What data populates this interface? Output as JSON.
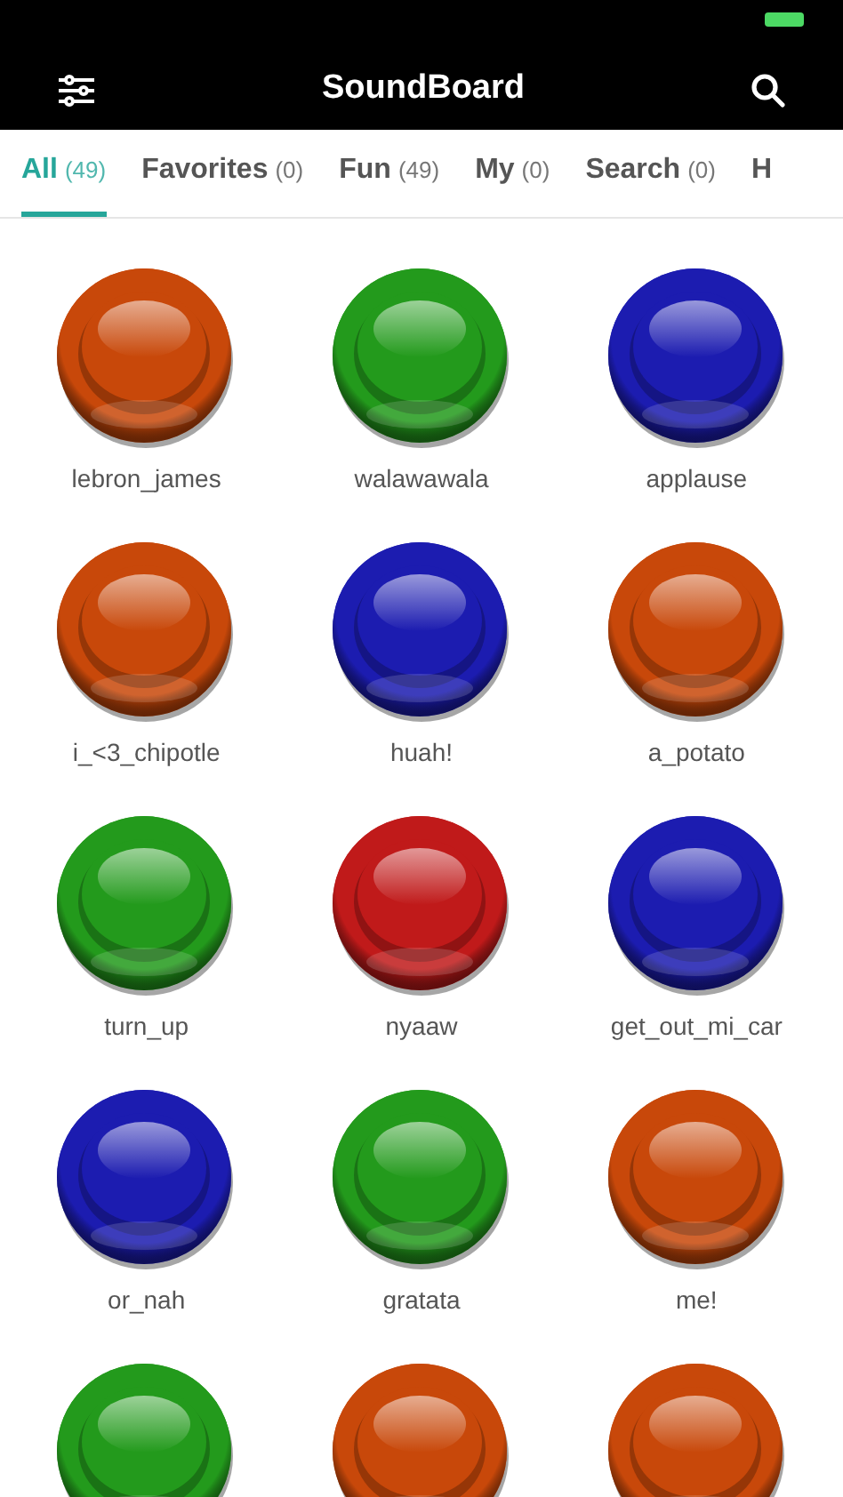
{
  "header": {
    "title": "SoundBoard"
  },
  "tabs": [
    {
      "label": "All",
      "count": "(49)",
      "selected": true
    },
    {
      "label": "Favorites",
      "count": "(0)",
      "selected": false
    },
    {
      "label": "Fun",
      "count": "(49)",
      "selected": false
    },
    {
      "label": "My",
      "count": "(0)",
      "selected": false
    },
    {
      "label": "Search",
      "count": "(0)",
      "selected": false
    },
    {
      "label": "H",
      "selected": false
    }
  ],
  "sounds": [
    {
      "label": "lebron_james",
      "color": "#c8480a"
    },
    {
      "label": "walawawala",
      "color": "#239a1c"
    },
    {
      "label": "applause",
      "color": "#1c1cb0"
    },
    {
      "label": "i_<3_chipotle",
      "color": "#c8480a"
    },
    {
      "label": "huah!",
      "color": "#1c1cb0"
    },
    {
      "label": "a_potato",
      "color": "#c8480a"
    },
    {
      "label": "turn_up",
      "color": "#239a1c"
    },
    {
      "label": "nyaaw",
      "color": "#c01a1a"
    },
    {
      "label": "get_out_mi_car",
      "color": "#1c1cb0"
    },
    {
      "label": "or_nah",
      "color": "#1c1cb0"
    },
    {
      "label": "gratata",
      "color": "#239a1c"
    },
    {
      "label": "me!",
      "color": "#c8480a"
    },
    {
      "color": "#239a1c"
    },
    {
      "color": "#c8480a"
    },
    {
      "color": "#c8480a"
    }
  ]
}
